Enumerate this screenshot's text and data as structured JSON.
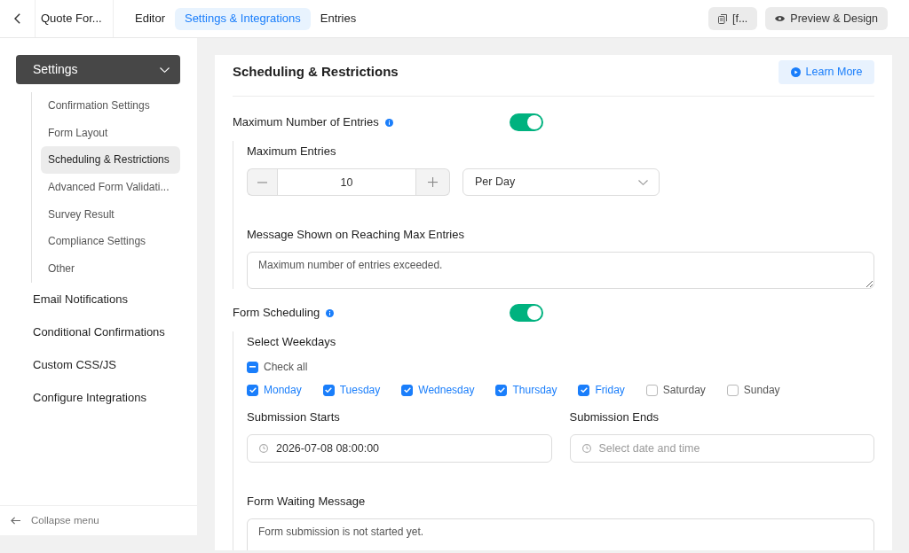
{
  "top_bar": {
    "form_title": "Quote For...",
    "tabs": [
      {
        "label": "Editor",
        "selected": false
      },
      {
        "label": "Settings & Integrations",
        "selected": true
      },
      {
        "label": "Entries",
        "selected": false
      }
    ],
    "buttons": [
      {
        "kind": "shortcode",
        "label": "[f..."
      },
      {
        "kind": "preview",
        "label": "Preview & Design"
      }
    ]
  },
  "sidebar": {
    "settings_menu": {
      "label": "Settings",
      "expanded": true,
      "items": [
        {
          "label": "Confirmation Settings",
          "selected": false
        },
        {
          "label": "Form Layout",
          "selected": false
        },
        {
          "label": "Scheduling & Restrictions",
          "selected": true
        },
        {
          "label": "Advanced Form Validati...",
          "selected": false
        },
        {
          "label": "Survey Result",
          "selected": false
        },
        {
          "label": "Compliance Settings",
          "selected": false
        },
        {
          "label": "Other",
          "selected": false
        }
      ]
    },
    "items": [
      {
        "label": "Email Notifications",
        "selected": false
      },
      {
        "label": "Conditional Confirmations",
        "selected": false
      },
      {
        "label": "Custom CSS/JS",
        "selected": false
      },
      {
        "label": "Configure Integrations",
        "selected": false
      }
    ],
    "collapse": "Collapse menu"
  },
  "panel": {
    "title": "Scheduling & Restrictions",
    "learn_more": "Learn More",
    "sections": [
      {
        "label": "Maximum Number of Entries",
        "on": true,
        "fields": [
          {
            "kind": "stepper",
            "label": "Maximum Entries",
            "value": "10",
            "period": "Per Day"
          },
          {
            "kind": "textarea",
            "label": "Message Shown on Reaching Max Entries",
            "value": "Maximum number of entries exceeded."
          }
        ]
      },
      {
        "label": "Form Scheduling",
        "on": true,
        "fields": [
          {
            "kind": "weekdays",
            "label": "Select Weekdays",
            "check_all": {
              "label": "Check all",
              "indeterminate": true
            },
            "days": [
              {
                "label": "Monday",
                "checked": true
              },
              {
                "label": "Tuesday",
                "checked": true
              },
              {
                "label": "Wednesday",
                "checked": true
              },
              {
                "label": "Thursday",
                "checked": true
              },
              {
                "label": "Friday",
                "checked": true
              },
              {
                "label": "Saturday",
                "checked": false
              },
              {
                "label": "Sunday",
                "checked": false
              }
            ]
          },
          {
            "kind": "date_range",
            "start": {
              "label": "Submission Starts",
              "value": "2026-07-08 08:00:00"
            },
            "end": {
              "label": "Submission Ends",
              "placeholder": "Select date and time"
            }
          },
          {
            "kind": "textarea",
            "label": "Form Waiting Message",
            "value": "Form submission is not started yet."
          }
        ]
      }
    ]
  }
}
